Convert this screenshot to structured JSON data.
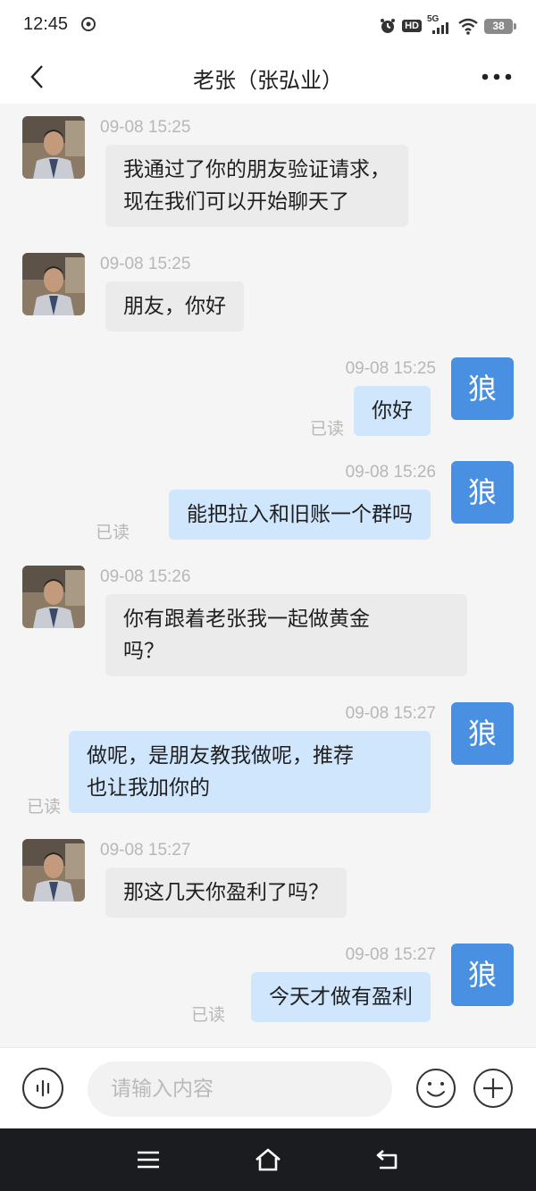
{
  "status_bar": {
    "time": "12:45",
    "network": "5G",
    "hd_label": "HD",
    "battery": "38"
  },
  "header": {
    "title": "老张（张弘业）"
  },
  "contact": {
    "out_avatar_char": "狼"
  },
  "messages": [
    {
      "direction": "in",
      "time": "09-08 15:25",
      "lines": [
        "我通过了你的朋友验证请求，",
        "现在我们可以开始聊天了"
      ]
    },
    {
      "direction": "in",
      "time": "09-08 15:25",
      "lines": [
        "朋友，你好"
      ]
    },
    {
      "direction": "out",
      "time": "09-08 15:25",
      "lines": [
        "你好"
      ],
      "read": "已读"
    },
    {
      "direction": "out",
      "time": "09-08 15:26",
      "lines": [
        "能把拉入和旧账一个群吗"
      ],
      "read": "已读"
    },
    {
      "direction": "in",
      "time": "09-08 15:26",
      "lines": [
        "你有跟着老张我一起做黄金",
        "吗？"
      ]
    },
    {
      "direction": "out",
      "time": "09-08 15:27",
      "lines": [
        "做呢，是朋友教我做呢，推荐",
        "也让我加你的"
      ],
      "read": "已读"
    },
    {
      "direction": "in",
      "time": "09-08 15:27",
      "lines": [
        "那这几天你盈利了吗？"
      ]
    },
    {
      "direction": "out",
      "time": "09-08 15:27",
      "lines": [
        "今天才做有盈利"
      ],
      "read": "已读"
    }
  ],
  "input_bar": {
    "placeholder": "请输入内容"
  },
  "colors": {
    "out_bubble": "#cfe6fd",
    "in_bubble": "#ebebeb",
    "avatar_out": "#4a90e2",
    "nav_bar": "#1b1c20"
  }
}
